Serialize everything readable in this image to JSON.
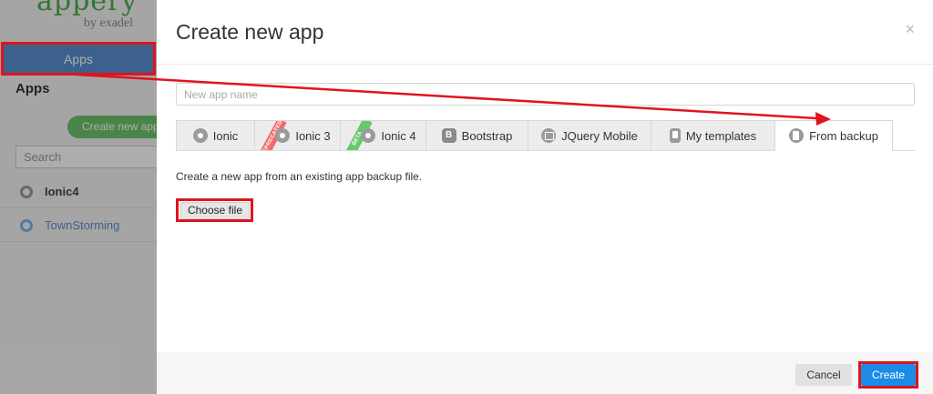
{
  "background_app": {
    "brand_sub": "by exadel",
    "nav_apps": "Apps",
    "heading": "Apps",
    "create_button": "Create new app",
    "search_placeholder": "Search",
    "apps": [
      {
        "name": "Ionic4"
      },
      {
        "name": "TownStorming"
      }
    ]
  },
  "modal": {
    "title": "Create new app",
    "close_glyph": "×",
    "app_name_placeholder": "New app name",
    "tabs": [
      {
        "label": "Ionic",
        "icon": "ionic-icon",
        "ribbon": ""
      },
      {
        "label": "Ionic 3",
        "icon": "ionic-icon",
        "ribbon": "DEPRECATED"
      },
      {
        "label": "Ionic 4",
        "icon": "ionic-icon",
        "ribbon": "BETA"
      },
      {
        "label": "Bootstrap",
        "icon": "bootstrap-icon",
        "icon_text": "B",
        "ribbon": ""
      },
      {
        "label": "JQuery Mobile",
        "icon": "jquery-mobile-icon",
        "ribbon": ""
      },
      {
        "label": "My templates",
        "icon": "phone-icon",
        "ribbon": ""
      },
      {
        "label": "From backup",
        "icon": "backup-file-icon",
        "ribbon": "",
        "active": true
      }
    ],
    "description": "Create a new app from an existing app backup file.",
    "choose_file_label": "Choose file",
    "cancel_label": "Cancel",
    "create_label": "Create"
  },
  "colors": {
    "primary_button": "#1a8ce8",
    "callout": "#e0141e",
    "nav_active": "#5a8fd0",
    "green_button": "#6cc46c"
  }
}
